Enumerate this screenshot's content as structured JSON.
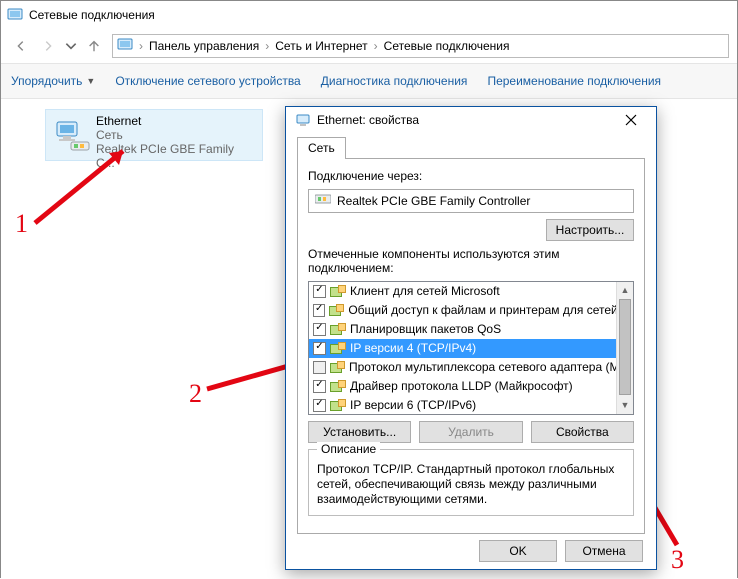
{
  "window": {
    "title": "Сетевые подключения"
  },
  "breadcrumb": {
    "a": "Панель управления",
    "b": "Сеть и Интернет",
    "c": "Сетевые подключения"
  },
  "toolbar": {
    "arrange": "Упорядочить",
    "disable": "Отключение сетевого устройства",
    "diag": "Диагностика подключения",
    "rename": "Переименование подключения"
  },
  "conn": {
    "name": "Ethernet",
    "sub": "Сеть",
    "driver": "Realtek PCIe GBE Family C..."
  },
  "dialog": {
    "title": "Ethernet: свойства",
    "tab": "Сеть",
    "connect_via": "Подключение через:",
    "adapter": "Realtek PCIe GBE Family Controller",
    "configure": "Настроить...",
    "components_label": "Отмеченные компоненты используются этим подключением:",
    "items": {
      "c0": "Клиент для сетей Microsoft",
      "c1": "Общий доступ к файлам и принтерам для сетей Mi",
      "c2": "Планировщик пакетов QoS",
      "c3": "IP версии 4 (TCP/IPv4)",
      "c4": "Протокол мультиплексора сетевого адаптера (Ма",
      "c5": "Драйвер протокола LLDP (Майкрософт)",
      "c6": "IP версии 6 (TCP/IPv6)"
    },
    "install": "Установить...",
    "remove": "Удалить",
    "properties": "Свойства",
    "desc_title": "Описание",
    "desc_text": "Протокол TCP/IP. Стандартный протокол глобальных сетей, обеспечивающий связь между различными взаимодействующими сетями.",
    "ok": "OK",
    "cancel": "Отмена"
  },
  "ann": {
    "n1": "1",
    "n2": "2",
    "n3": "3"
  }
}
